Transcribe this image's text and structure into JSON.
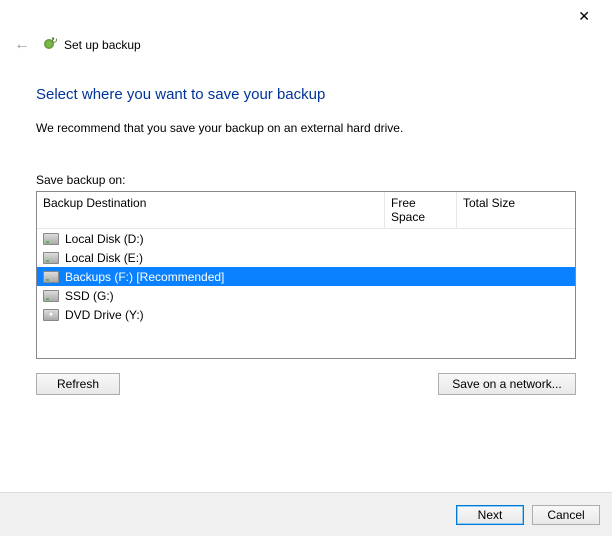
{
  "window": {
    "title": "Set up backup"
  },
  "main": {
    "title": "Select where you want to save your backup",
    "subtitle": "We recommend that you save your backup on an external hard drive.",
    "list_label": "Save backup on:"
  },
  "columns": {
    "destination": "Backup Destination",
    "free_space": "Free Space",
    "total_size": "Total Size"
  },
  "drives": [
    {
      "label": "Local Disk (D:)",
      "icon": "hdd",
      "selected": false
    },
    {
      "label": "Local Disk (E:)",
      "icon": "hdd",
      "selected": false
    },
    {
      "label": "Backups (F:) [Recommended]",
      "icon": "hdd",
      "selected": true
    },
    {
      "label": "SSD (G:)",
      "icon": "hdd",
      "selected": false
    },
    {
      "label": "DVD Drive (Y:)",
      "icon": "dvd",
      "selected": false
    }
  ],
  "buttons": {
    "refresh": "Refresh",
    "network": "Save on a network...",
    "next": "Next",
    "cancel": "Cancel"
  }
}
